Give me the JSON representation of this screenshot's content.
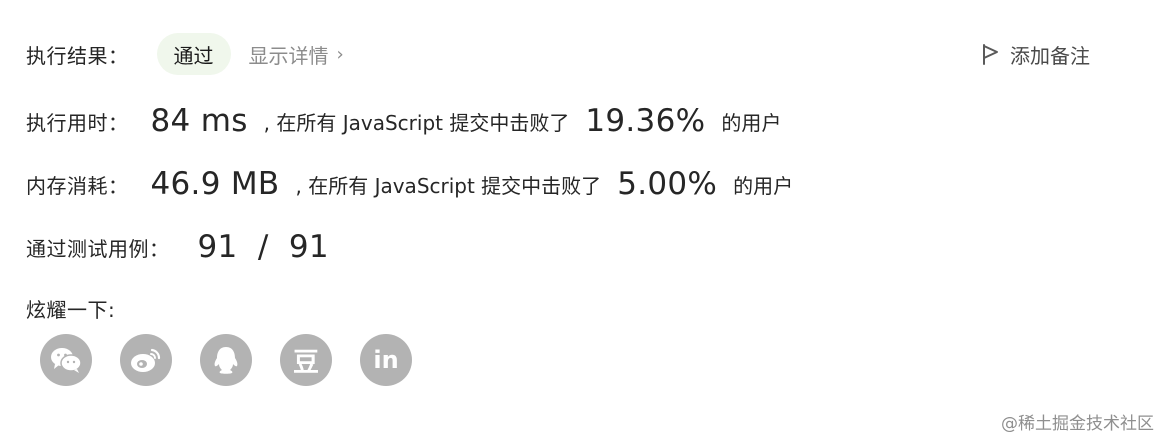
{
  "result": {
    "label": "执行结果：",
    "status": "通过",
    "details_link": "显示详情",
    "details_chevron": "›"
  },
  "note": {
    "label": "添加备注",
    "icon": "flag-icon"
  },
  "runtime": {
    "label": "执行用时：",
    "value": "84 ms",
    "separator": ", 在所有 JavaScript 提交中击败了",
    "percent": "19.36%",
    "suffix": "的用户"
  },
  "memory": {
    "label": "内存消耗：",
    "value": "46.9 MB",
    "separator": ", 在所有 JavaScript 提交中击败了",
    "percent": "5.00%",
    "suffix": "的用户"
  },
  "testcases": {
    "label": "通过测试用例：",
    "value": "91  /  91"
  },
  "share": {
    "label": "炫耀一下:",
    "icons": [
      "wechat-icon",
      "weibo-icon",
      "qq-icon",
      "douban-icon",
      "linkedin-icon"
    ],
    "douban_glyph": "豆",
    "linkedin_glyph": "in"
  },
  "watermark": "@稀土掘金技术社区",
  "colors": {
    "status_badge_bg": "#f0f7ec",
    "icon_bg": "#b3b3b3",
    "muted_text": "#8c8c8c"
  }
}
